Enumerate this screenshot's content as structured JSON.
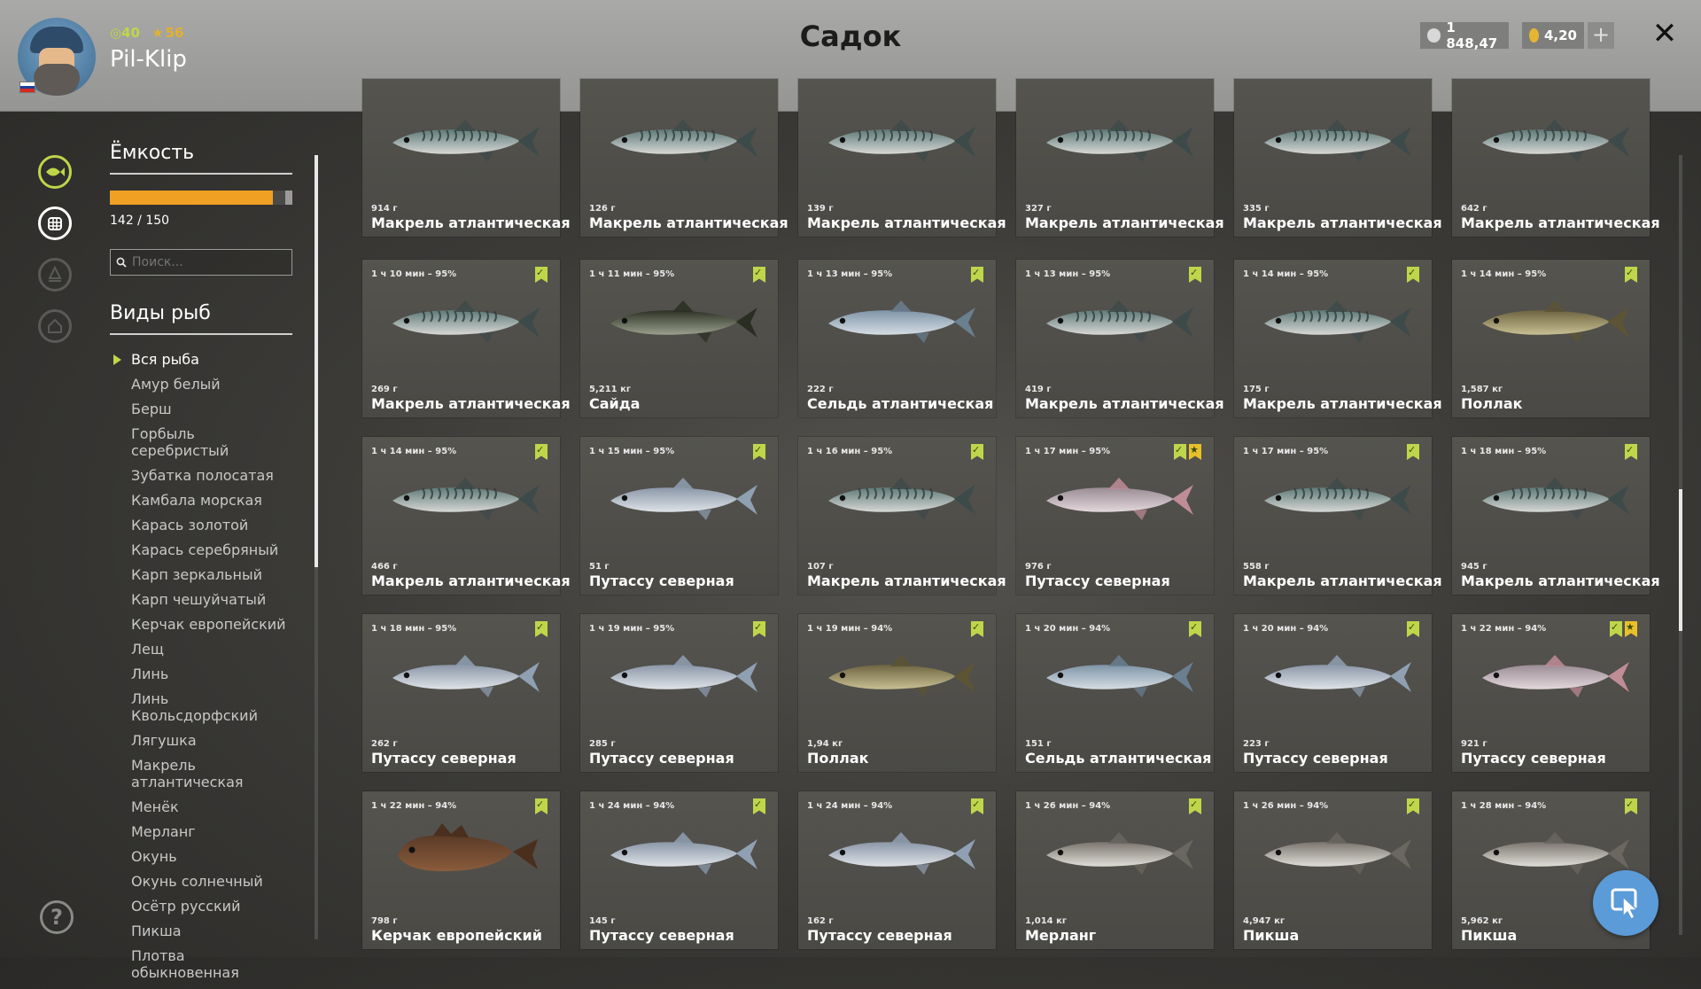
{
  "header": {
    "player_name": "Pil-Klip",
    "level": "40",
    "rank": "56",
    "title": "Садок",
    "silver": "1 848,47",
    "gold": "4,20",
    "plus_label": "+",
    "close_label": "✕",
    "flag_colors": [
      "#ffffff",
      "#1c3f9e",
      "#d52b1e"
    ]
  },
  "nav": {
    "icons": [
      "fish-icon",
      "keepnet-icon",
      "campfire-icon",
      "home-icon"
    ],
    "help_label": "?"
  },
  "sidebar": {
    "capacity_title": "Ёмкость",
    "capacity_current": 142,
    "capacity_max": 150,
    "capacity_text": "142 / 150",
    "search_placeholder": "Поиск...",
    "species_title": "Виды рыб",
    "species": [
      "Вся рыба",
      "Амур белый",
      "Берш",
      "Горбыль серебристый",
      "Зубатка полосатая",
      "Камбала морская",
      "Карась золотой",
      "Карась серебряный",
      "Карп зеркальный",
      "Карп чешуйчатый",
      "Керчак европейский",
      "Лещ",
      "Линь",
      "Линь Квольсдорфский",
      "Лягушка",
      "Макрель атлантическая",
      "Менёк",
      "Мерланг",
      "Окунь",
      "Окунь солнечный",
      "Осётр русский",
      "Пикша",
      "Плотва обыкновенная"
    ],
    "active_species": 0
  },
  "colors": {
    "accent_green": "#bfd64a",
    "accent_gold": "#e8c02a",
    "capacity_orange": "#f0a022",
    "fab_blue": "#5b9bd8"
  },
  "fish_cards": [
    [
      {
        "time": "",
        "weight": "914 г",
        "name": "Макрель атлантическая",
        "kind": "mackerel",
        "badges": []
      },
      {
        "time": "",
        "weight": "126 г",
        "name": "Макрель атлантическая",
        "kind": "mackerel",
        "badges": []
      },
      {
        "time": "",
        "weight": "139 г",
        "name": "Макрель атлантическая",
        "kind": "mackerel",
        "badges": []
      },
      {
        "time": "",
        "weight": "327 г",
        "name": "Макрель атлантическая",
        "kind": "mackerel",
        "badges": []
      },
      {
        "time": "",
        "weight": "335 г",
        "name": "Макрель атлантическая",
        "kind": "mackerel",
        "badges": []
      },
      {
        "time": "",
        "weight": "642 г",
        "name": "Макрель атлантическая",
        "kind": "mackerel",
        "badges": []
      }
    ],
    [
      {
        "time": "1 ч 10 мин – 95%",
        "weight": "269 г",
        "name": "Макрель атлантическая",
        "kind": "mackerel",
        "badges": [
          "check"
        ]
      },
      {
        "time": "1 ч 11 мин – 95%",
        "weight": "5,211 кг",
        "name": "Сайда",
        "kind": "saithe",
        "badges": [
          "check"
        ]
      },
      {
        "time": "1 ч 13 мин – 95%",
        "weight": "222 г",
        "name": "Сельдь атлантическая",
        "kind": "herring",
        "badges": [
          "check"
        ]
      },
      {
        "time": "1 ч 13 мин – 95%",
        "weight": "419 г",
        "name": "Макрель атлантическая",
        "kind": "mackerel",
        "badges": [
          "check"
        ]
      },
      {
        "time": "1 ч 14 мин – 95%",
        "weight": "175 г",
        "name": "Макрель атлантическая",
        "kind": "mackerel",
        "badges": [
          "check"
        ]
      },
      {
        "time": "1 ч 14 мин – 95%",
        "weight": "1,587 кг",
        "name": "Поллак",
        "kind": "pollack",
        "badges": [
          "check"
        ]
      }
    ],
    [
      {
        "time": "1 ч 14 мин – 95%",
        "weight": "466 г",
        "name": "Макрель атлантическая",
        "kind": "mackerel",
        "badges": [
          "check"
        ]
      },
      {
        "time": "1 ч 15 мин – 95%",
        "weight": "51 г",
        "name": "Путассу северная",
        "kind": "whiting",
        "badges": [
          "check"
        ]
      },
      {
        "time": "1 ч 16 мин – 95%",
        "weight": "107 г",
        "name": "Макрель атлантическая",
        "kind": "mackerel",
        "badges": [
          "check"
        ]
      },
      {
        "time": "1 ч 17 мин – 95%",
        "weight": "976 г",
        "name": "Путассу северная",
        "kind": "whiting-pink",
        "badges": [
          "check",
          "star"
        ]
      },
      {
        "time": "1 ч 17 мин – 95%",
        "weight": "558 г",
        "name": "Макрель атлантическая",
        "kind": "mackerel",
        "badges": [
          "check"
        ]
      },
      {
        "time": "1 ч 18 мин – 95%",
        "weight": "945 г",
        "name": "Макрель атлантическая",
        "kind": "mackerel",
        "badges": [
          "check"
        ]
      }
    ],
    [
      {
        "time": "1 ч 18 мин – 95%",
        "weight": "262 г",
        "name": "Путассу северная",
        "kind": "whiting",
        "badges": [
          "check"
        ]
      },
      {
        "time": "1 ч 19 мин – 95%",
        "weight": "285 г",
        "name": "Путассу северная",
        "kind": "whiting",
        "badges": [
          "check"
        ]
      },
      {
        "time": "1 ч 19 мин – 94%",
        "weight": "1,94 кг",
        "name": "Поллак",
        "kind": "pollack",
        "badges": [
          "check"
        ]
      },
      {
        "time": "1 ч 20 мин – 94%",
        "weight": "151 г",
        "name": "Сельдь атлантическая",
        "kind": "herring",
        "badges": [
          "check"
        ]
      },
      {
        "time": "1 ч 20 мин – 94%",
        "weight": "223 г",
        "name": "Путассу северная",
        "kind": "whiting",
        "badges": [
          "check"
        ]
      },
      {
        "time": "1 ч 22 мин – 94%",
        "weight": "921 г",
        "name": "Путассу северная",
        "kind": "whiting-pink",
        "badges": [
          "check",
          "star"
        ]
      }
    ],
    [
      {
        "time": "1 ч 22 мин – 94%",
        "weight": "798 г",
        "name": "Керчак европейский",
        "kind": "sculpin",
        "badges": [
          "check"
        ]
      },
      {
        "time": "1 ч 24 мин – 94%",
        "weight": "145 г",
        "name": "Путассу северная",
        "kind": "whiting",
        "badges": [
          "check"
        ]
      },
      {
        "time": "1 ч 24 мин – 94%",
        "weight": "162 г",
        "name": "Путассу северная",
        "kind": "whiting",
        "badges": [
          "check"
        ]
      },
      {
        "time": "1 ч 26 мин – 94%",
        "weight": "1,014 кг",
        "name": "Мерланг",
        "kind": "haddock",
        "badges": [
          "check"
        ]
      },
      {
        "time": "1 ч 26 мин – 94%",
        "weight": "4,947 кг",
        "name": "Пикша",
        "kind": "haddock",
        "badges": [
          "check"
        ]
      },
      {
        "time": "1 ч 28 мин – 94%",
        "weight": "5,962 кг",
        "name": "Пикша",
        "kind": "haddock",
        "badges": [
          "check"
        ]
      }
    ]
  ]
}
